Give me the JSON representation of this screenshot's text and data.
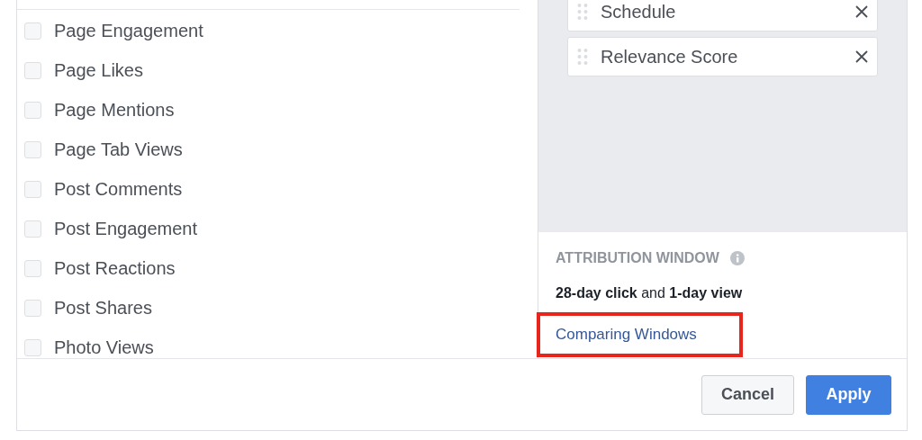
{
  "metrics": [
    {
      "label": "Page Engagement",
      "checked": false
    },
    {
      "label": "Page Likes",
      "checked": false
    },
    {
      "label": "Page Mentions",
      "checked": false
    },
    {
      "label": "Page Tab Views",
      "checked": false
    },
    {
      "label": "Post Comments",
      "checked": false
    },
    {
      "label": "Post Engagement",
      "checked": false
    },
    {
      "label": "Post Reactions",
      "checked": false
    },
    {
      "label": "Post Shares",
      "checked": false
    },
    {
      "label": "Photo Views",
      "checked": false
    }
  ],
  "selected_columns": [
    {
      "label": "Schedule"
    },
    {
      "label": "Relevance Score"
    }
  ],
  "attribution": {
    "title": "ATTRIBUTION WINDOW",
    "summary": "**28-day click** and **1-day view**",
    "link": "Comparing Windows",
    "highlighted": true
  },
  "buttons": [
    {
      "label": "Cancel",
      "kind": "secondary"
    },
    {
      "label": "Apply",
      "kind": "primary"
    }
  ]
}
